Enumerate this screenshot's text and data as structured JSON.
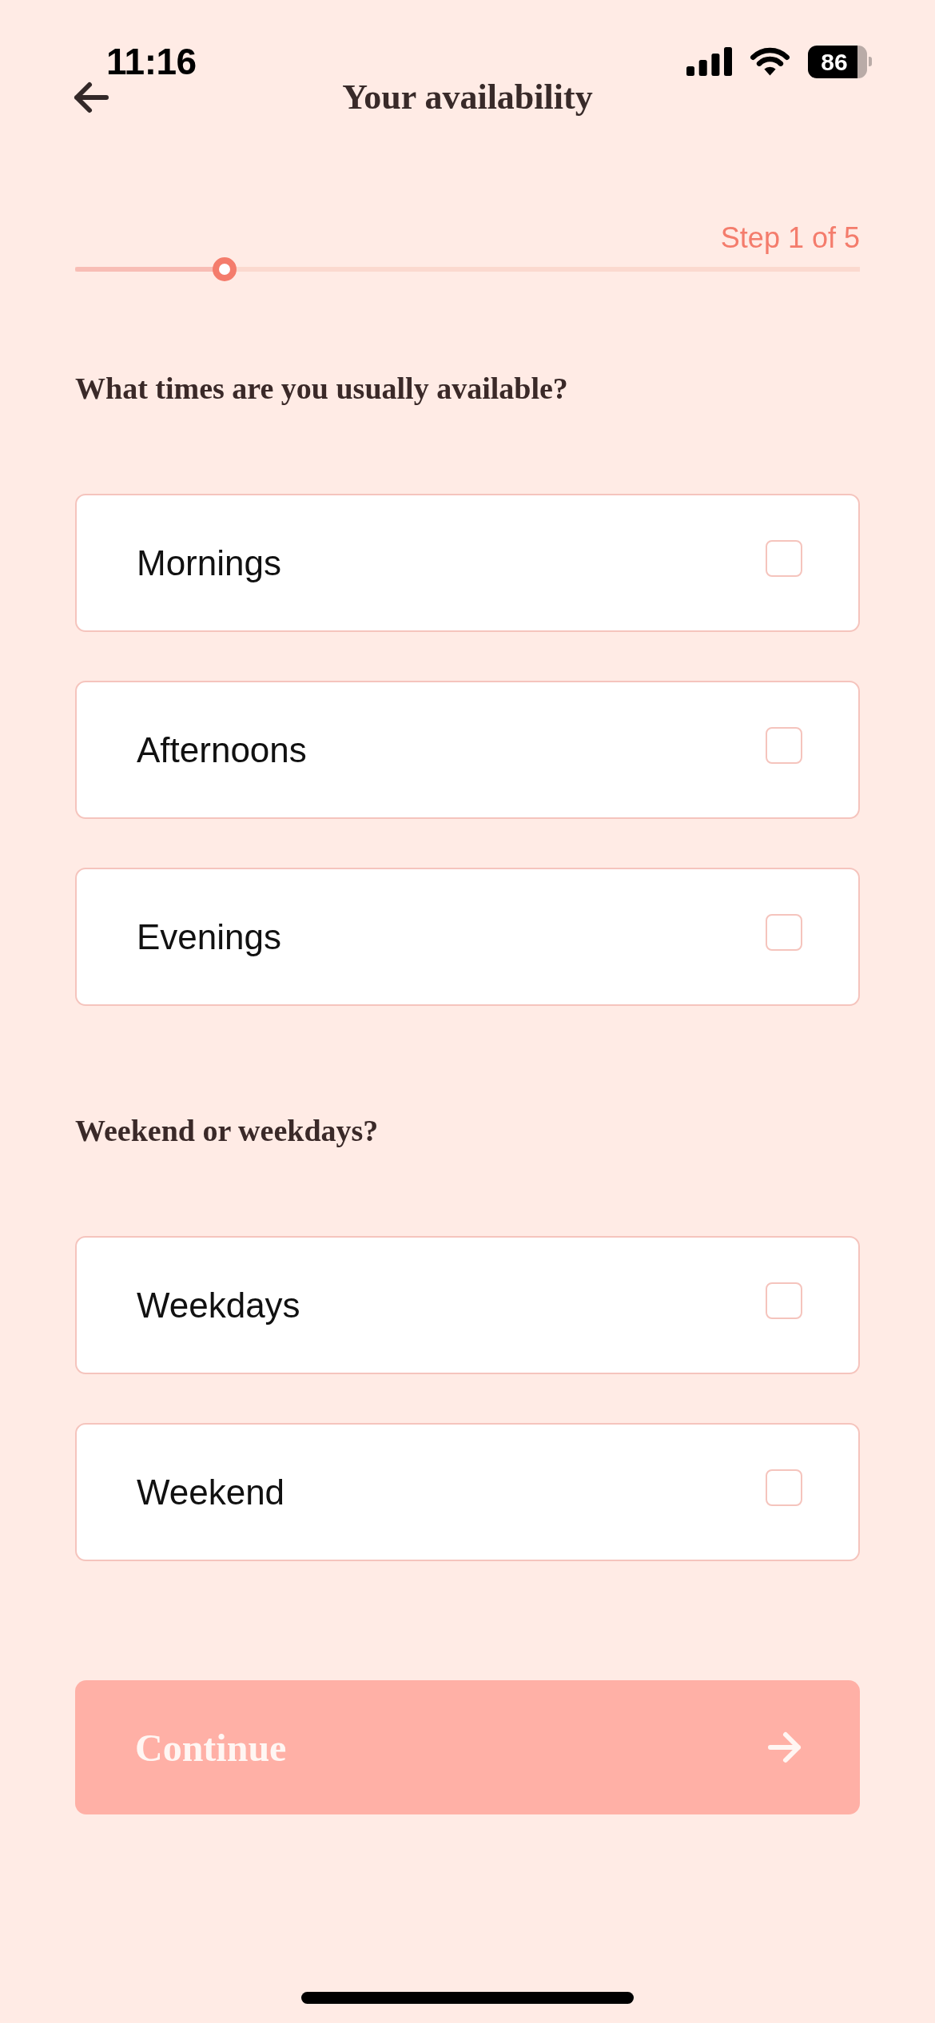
{
  "status_bar": {
    "time": "11:16",
    "battery": "86"
  },
  "header": {
    "title": "Your availability"
  },
  "progress": {
    "label": "Step 1 of 5",
    "level": 0.19
  },
  "sections": [
    {
      "question": "What times are you usually available?",
      "options": [
        {
          "label": "Mornings",
          "checked": false
        },
        {
          "label": "Afternoons",
          "checked": false
        },
        {
          "label": "Evenings",
          "checked": false
        }
      ]
    },
    {
      "question": "Weekend or weekdays?",
      "options": [
        {
          "label": "Weekdays",
          "checked": false
        },
        {
          "label": "Weekend",
          "checked": false
        }
      ]
    }
  ],
  "continue_button": {
    "label": "Continue",
    "disabled": true
  }
}
